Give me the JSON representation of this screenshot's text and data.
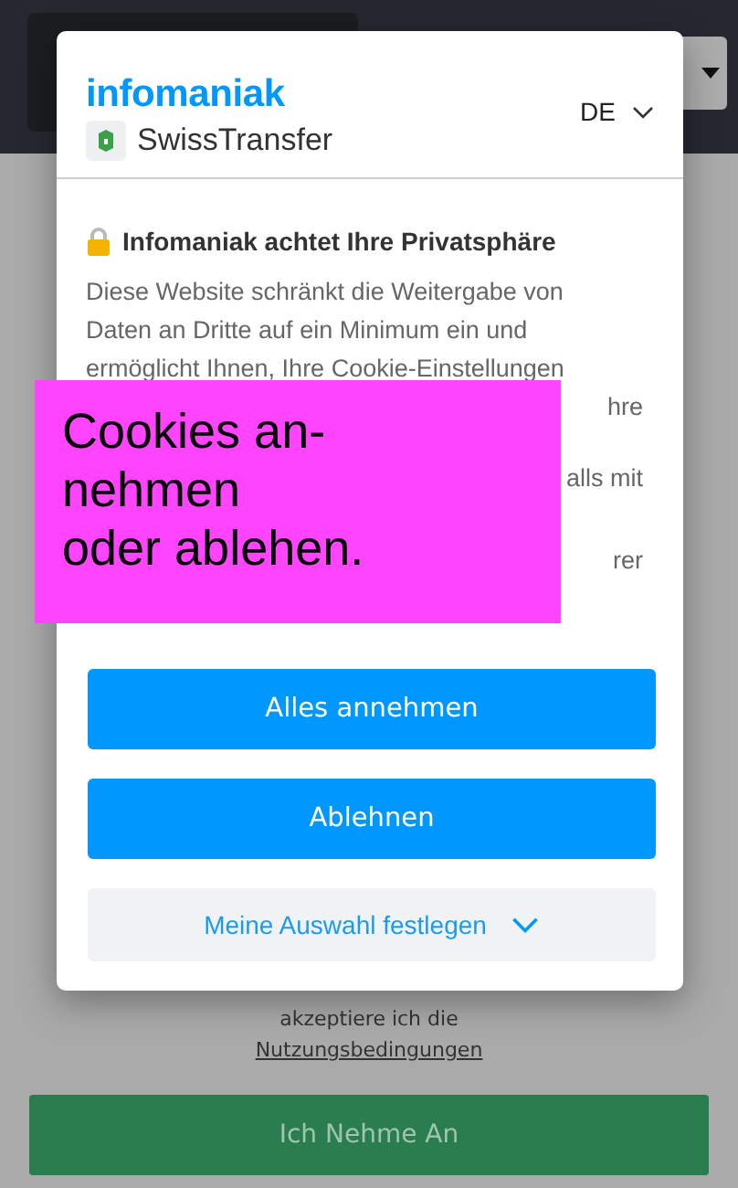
{
  "page": {
    "terms_line": "akzeptiere ich die",
    "terms_link": "Nutzungsbedingungen",
    "accept_button": "Ich Nehme An"
  },
  "dialog": {
    "brand": "infomaniak",
    "product": "SwissTransfer",
    "language": "DE",
    "title": "Infomaniak achtet Ihre Privatsphäre",
    "text_lines": [
      {
        "text": "Diese Website schränkt die Weitergabe von",
        "kind": "full"
      },
      {
        "text": "Daten an Dritte auf ein Minimum ein und",
        "kind": "full"
      },
      {
        "text": "ermöglicht Ihnen, Ihre Cookie-Einstellungen",
        "kind": "full"
      },
      {
        "text": "hre",
        "kind": "fragment"
      },
      {
        "text": "alls mit",
        "kind": "fragment"
      },
      {
        "text": "rer",
        "kind": "fragment"
      }
    ],
    "buttons": [
      {
        "label": "Alles annehmen",
        "kind": "primary"
      },
      {
        "label": "Ablehnen",
        "kind": "primary"
      },
      {
        "label": "Meine Auswahl festlegen",
        "kind": "expand"
      }
    ]
  },
  "callout": {
    "lines": [
      "Cookies an-",
      "nehmen",
      "oder ablehen."
    ]
  }
}
